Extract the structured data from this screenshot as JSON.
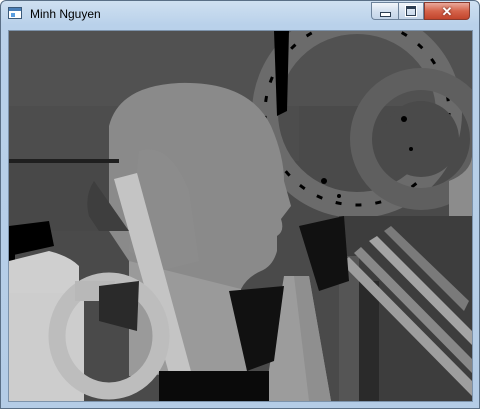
{
  "window": {
    "title": "Minh Nguyen",
    "controls": {
      "minimize": "minimize",
      "maximize": "maximize",
      "close": "close"
    }
  },
  "image": {
    "description_icon": "depth-map-image"
  }
}
